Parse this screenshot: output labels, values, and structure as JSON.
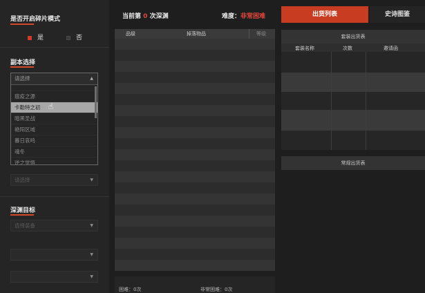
{
  "left": {
    "shard_mode": {
      "title": "是否开启碎片模式",
      "yes": "是",
      "no": "否",
      "selected": "是"
    },
    "dungeon": {
      "title": "副本选择",
      "placeholder": "请选择",
      "options": [
        "",
        "瘟疫之源",
        "卡勒特之初",
        "暗黑圣战",
        "艳阳区域",
        "暮日哀鸣",
        "魂冬",
        "逆之觉悟"
      ],
      "highlighted": "卡勒特之初"
    },
    "second_select": {
      "placeholder": "请选择"
    },
    "target": {
      "title": "深渊目标",
      "select_equipment": "选择装备"
    }
  },
  "middle": {
    "round_prefix": "当前第",
    "round_num": "0",
    "round_suffix": "次深渊",
    "difficulty_label": "难度：",
    "difficulty_value": "非常困难",
    "columns": [
      "品级",
      "掉落物品",
      "等级"
    ],
    "footer": {
      "hard": "困难：0次",
      "very_hard": "非常困难：0次"
    }
  },
  "right": {
    "tabs": [
      "出货列表",
      "史诗图鉴"
    ],
    "active_tab": "出货列表",
    "set_table": {
      "title": "套装出货表",
      "columns": [
        "套装名称",
        "次数",
        "邀请函"
      ]
    },
    "normal_table": {
      "title": "常规出货表"
    }
  },
  "colors": {
    "accent": "#c83d22",
    "highlight_red": "#e0463a",
    "background": "#1e1e1e"
  }
}
